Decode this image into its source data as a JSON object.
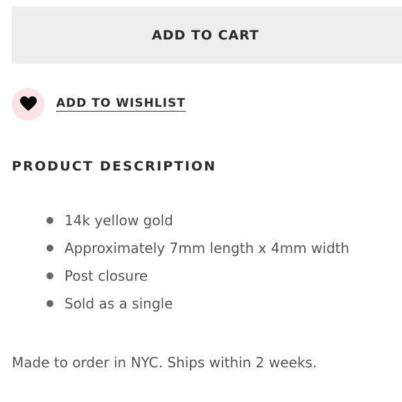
{
  "cart": {
    "button_label": "ADD TO CART"
  },
  "wishlist": {
    "label": "ADD TO WISHLIST",
    "icon": "heart-icon",
    "icon_color": "#000000",
    "icon_background": "#fde3e6"
  },
  "description": {
    "title": "PRODUCT DESCRIPTION",
    "features": [
      "14k yellow gold",
      "Approximately 7mm length x 4mm width",
      "Post closure",
      "Sold as a single"
    ],
    "note": "Made to order in NYC. Ships within 2 weeks."
  },
  "colors": {
    "button_background": "#eeeeee",
    "text_dark": "#2b2b2b",
    "text_body": "#555555"
  }
}
